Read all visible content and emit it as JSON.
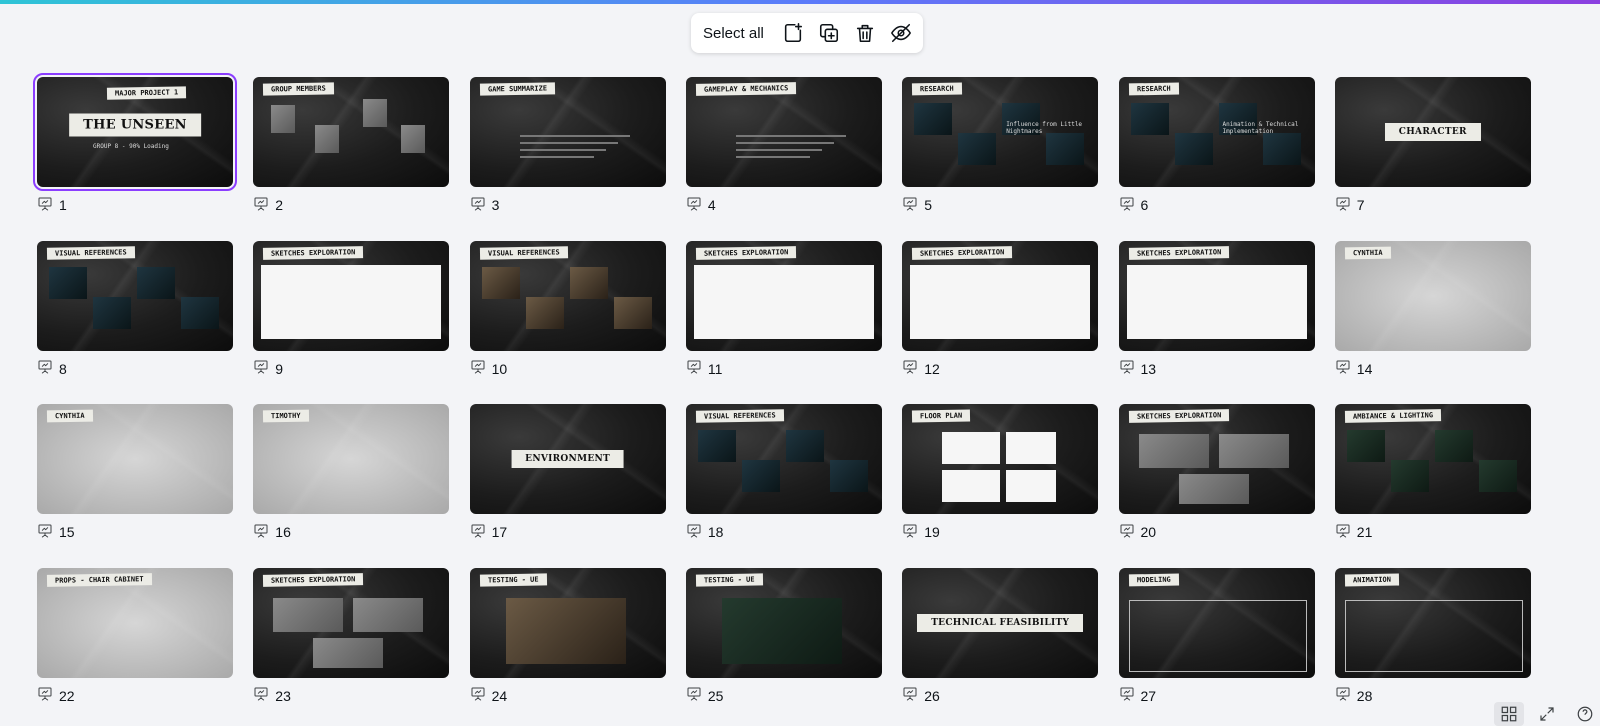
{
  "toolbar": {
    "select_all": "Select all",
    "buttons": [
      "add-page-icon",
      "duplicate-icon",
      "trash-icon",
      "hide-icon"
    ]
  },
  "accent": "#8b3dff",
  "slides": [
    {
      "num": "1",
      "title": "THE UNSEEN",
      "subtitle": "GROUP 8 - 90% Loading",
      "tag": "MAJOR PROJECT 1",
      "selected": true
    },
    {
      "num": "2",
      "tag": "GROUP MEMBERS"
    },
    {
      "num": "3",
      "tag": "GAME SUMMARIZE"
    },
    {
      "num": "4",
      "tag": "GAMEPLAY & MECHANICS"
    },
    {
      "num": "5",
      "tag": "RESEARCH",
      "subtitle": "Influence from Little Nightmares"
    },
    {
      "num": "6",
      "tag": "RESEARCH",
      "subtitle": "Animation & Technical Implementation"
    },
    {
      "num": "7",
      "title": "CHARACTER"
    },
    {
      "num": "8",
      "tag": "VISUAL REFERENCES"
    },
    {
      "num": "9",
      "tag": "SKETCHES EXPLORATION"
    },
    {
      "num": "10",
      "tag": "VISUAL REFERENCES"
    },
    {
      "num": "11",
      "tag": "SKETCHES EXPLORATION"
    },
    {
      "num": "12",
      "tag": "SKETCHES EXPLORATION"
    },
    {
      "num": "13",
      "tag": "SKETCHES EXPLORATION"
    },
    {
      "num": "14",
      "tag": "CYNTHIA"
    },
    {
      "num": "15",
      "tag": "CYNTHIA"
    },
    {
      "num": "16",
      "tag": "TIMOTHY"
    },
    {
      "num": "17",
      "title": "ENVIRONMENT"
    },
    {
      "num": "18",
      "tag": "VISUAL REFERENCES"
    },
    {
      "num": "19",
      "tag": "FLOOR PLAN"
    },
    {
      "num": "20",
      "tag": "SKETCHES EXPLORATION"
    },
    {
      "num": "21",
      "tag": "AMBIANCE & LIGHTING"
    },
    {
      "num": "22",
      "tag": "PROPS - CHAIR CABINET"
    },
    {
      "num": "23",
      "tag": "SKETCHES EXPLORATION"
    },
    {
      "num": "24",
      "tag": "TESTING - UE"
    },
    {
      "num": "25",
      "tag": "TESTING - UE"
    },
    {
      "num": "26",
      "title": "TECHNICAL FEASIBILITY"
    },
    {
      "num": "27",
      "tag": "MODELING"
    },
    {
      "num": "28",
      "tag": "ANIMATION"
    }
  ],
  "bottom_icons": [
    "grid-view-icon",
    "fullscreen-icon",
    "help-icon"
  ]
}
